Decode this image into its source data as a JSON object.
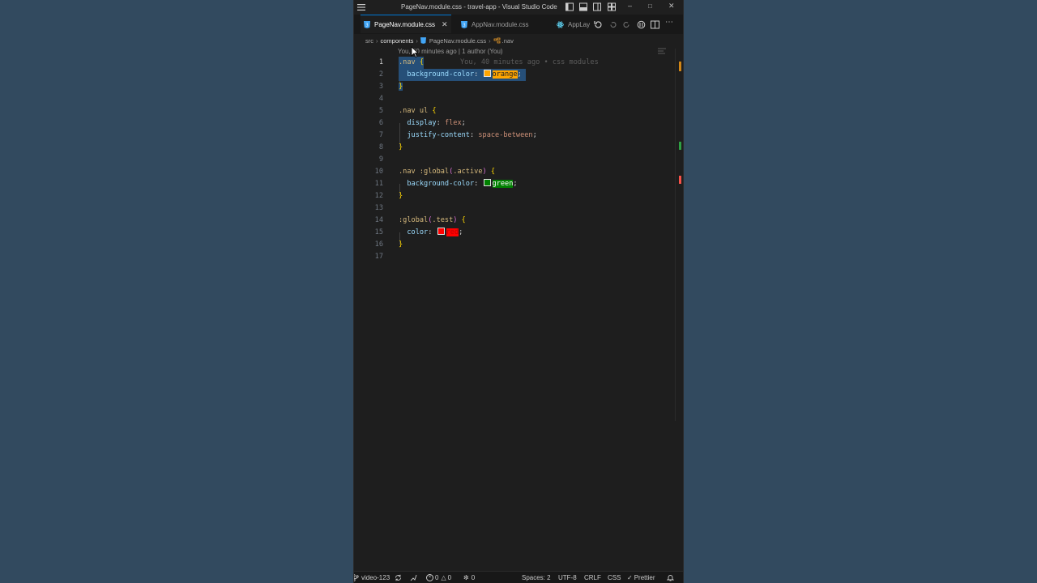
{
  "window": {
    "title": "PageNav.module.css - travel-app - Visual Studio Code"
  },
  "tabs": [
    {
      "label": "PageNav.module.css",
      "icon": "css-file-icon",
      "active": true
    },
    {
      "label": "AppNav.module.css",
      "icon": "css-file-icon",
      "active": false
    },
    {
      "label": "AppLay",
      "icon": "react-file-icon",
      "active": false
    }
  ],
  "breadcrumb": {
    "items": [
      "src",
      "components",
      "PageNav.module.css",
      ".nav"
    ]
  },
  "blame": {
    "header": "You, 40 minutes ago | 1 author (You)",
    "inline": "You, 40 minutes ago • css modules"
  },
  "editor": {
    "current_line": 1,
    "lines": [
      {
        "n": "1"
      },
      {
        "n": "2"
      },
      {
        "n": "3"
      },
      {
        "n": "4"
      },
      {
        "n": "5"
      },
      {
        "n": "6"
      },
      {
        "n": "7"
      },
      {
        "n": "8"
      },
      {
        "n": "9"
      },
      {
        "n": "10"
      },
      {
        "n": "11"
      },
      {
        "n": "12"
      },
      {
        "n": "13"
      },
      {
        "n": "14"
      },
      {
        "n": "15"
      },
      {
        "n": "16"
      },
      {
        "n": "17"
      }
    ],
    "code": {
      "l1_selector": ".nav",
      "brace_open": "{",
      "brace_close": "}",
      "prop_bg": "background-color",
      "colon": ":",
      "semi": ";",
      "val_orange": "orange",
      "l5_selector": ".nav ul",
      "prop_display": "display",
      "val_flex": "flex",
      "prop_justify": "justify-content",
      "val_space": "space-between",
      "l10_sel_a": ".nav ",
      "l10_sel_b": ":global",
      "paren_open": "(",
      "paren_close": ")",
      "l10_class": ".active",
      "val_green": "green",
      "l14_sel_a": ":global",
      "l14_class": ".test",
      "prop_color": "color",
      "val_red": "red"
    }
  },
  "colors": {
    "orange": "#ffa500",
    "green": "#008000",
    "red": "#ff0000",
    "accent": "#0078d4"
  },
  "statusbar": {
    "branch": "video-123",
    "errors": "0",
    "warnings": "0",
    "ports": "0",
    "spaces": "Spaces: 2",
    "encoding": "UTF-8",
    "eol": "CRLF",
    "language": "CSS",
    "formatter": "Prettier"
  }
}
